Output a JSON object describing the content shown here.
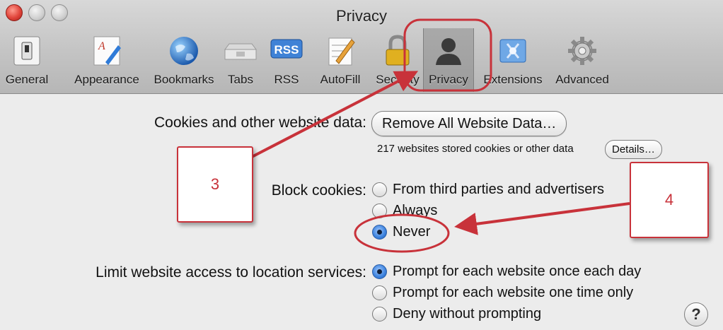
{
  "window": {
    "title": "Privacy"
  },
  "toolbar": {
    "items": [
      {
        "label": "General",
        "icon": "general-switch-icon"
      },
      {
        "label": "Appearance",
        "icon": "appearance-icon"
      },
      {
        "label": "Bookmarks",
        "icon": "globe-icon"
      },
      {
        "label": "Tabs",
        "icon": "tabs-icon"
      },
      {
        "label": "RSS",
        "icon": "rss-icon"
      },
      {
        "label": "AutoFill",
        "icon": "autofill-pencil-icon"
      },
      {
        "label": "Security",
        "icon": "lock-icon"
      },
      {
        "label": "Privacy",
        "icon": "person-silhouette-icon",
        "selected": true
      },
      {
        "label": "Extensions",
        "icon": "extensions-icon"
      },
      {
        "label": "Advanced",
        "icon": "gear-icon"
      }
    ]
  },
  "cookies": {
    "label": "Cookies and other website data:",
    "remove_button": "Remove All Website Data…",
    "stored_text": "217 websites stored cookies or other data",
    "details_button": "Details…"
  },
  "block_cookies": {
    "label": "Block cookies:",
    "options": [
      "From third parties and advertisers",
      "Always",
      "Never"
    ],
    "selected": "Never"
  },
  "location": {
    "label": "Limit website access to location services:",
    "options": [
      "Prompt for each website once each day",
      "Prompt for each website one time only",
      "Deny without prompting"
    ],
    "selected": "Prompt for each website once each day"
  },
  "help": {
    "label": "?"
  },
  "annotations": {
    "callout_3": "3",
    "callout_4": "4",
    "color": "#c8323a"
  }
}
